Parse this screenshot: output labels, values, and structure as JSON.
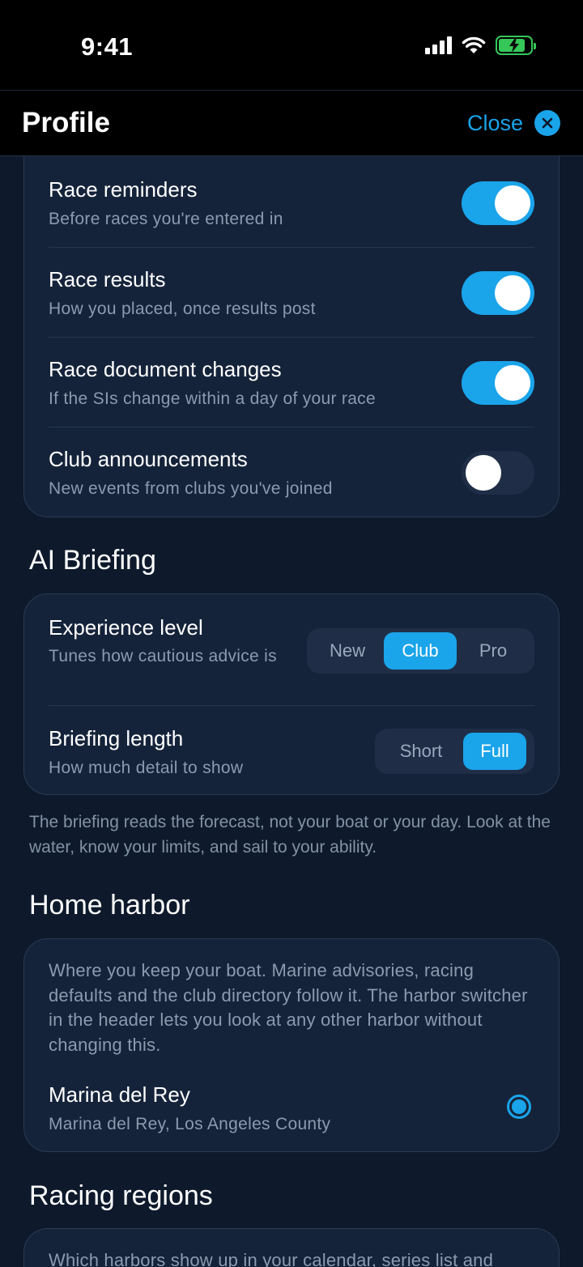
{
  "status_bar": {
    "time": "9:41"
  },
  "header": {
    "title": "Profile",
    "close_label": "Close"
  },
  "notifications": [
    {
      "title": "Race reminders",
      "subtitle": "Before races you're entered in",
      "enabled": true
    },
    {
      "title": "Race results",
      "subtitle": "How you placed, once results post",
      "enabled": true
    },
    {
      "title": "Race document changes",
      "subtitle": "If the SIs change within a day of your race",
      "enabled": true
    },
    {
      "title": "Club announcements",
      "subtitle": "New events from clubs you've joined",
      "enabled": false
    }
  ],
  "ai_briefing": {
    "title": "AI Briefing",
    "experience": {
      "title": "Experience level",
      "subtitle": "Tunes how cautious advice is",
      "options": [
        "New",
        "Club",
        "Pro"
      ],
      "selected": "Club"
    },
    "length": {
      "title": "Briefing length",
      "subtitle": "How much detail to show",
      "options": [
        "Short",
        "Full"
      ],
      "selected": "Full"
    },
    "note": "The briefing reads the forecast, not your boat or your day. Look at the water, know your limits, and sail to your ability."
  },
  "home_harbor": {
    "title": "Home harbor",
    "description": "Where you keep your boat. Marine advisories, racing defaults and the club directory follow it. The harbor switcher in the header lets you look at any other harbor without changing this.",
    "harbor_name": "Marina del Rey",
    "harbor_location": "Marina del Rey, Los Angeles County",
    "selected": true
  },
  "racing_regions": {
    "title": "Racing regions",
    "description": "Which harbors show up in your calendar, series list and"
  },
  "colors": {
    "accent": "#1aa4ea",
    "background": "#0e1a2c",
    "card": "#15233a",
    "battery": "#36c759"
  }
}
